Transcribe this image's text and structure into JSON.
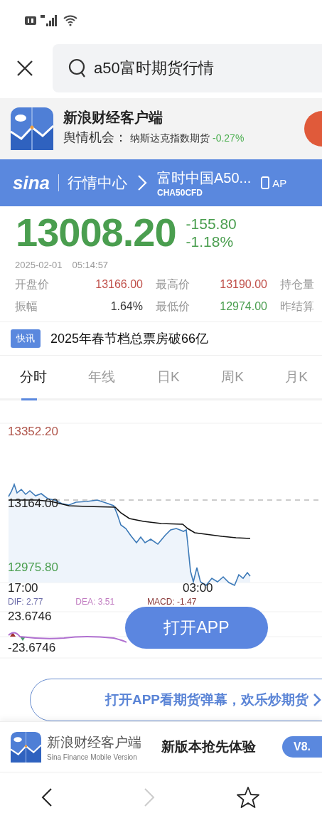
{
  "search": {
    "value": "a50富时期货行情"
  },
  "promo_banner": {
    "title": "新浪财经客户端",
    "label": "舆情机会：",
    "item": "纳斯达克指数期货",
    "change": "-0.27%"
  },
  "header": {
    "logo": "sina",
    "section": "行情中心",
    "title": "富时中国A50...",
    "code": "CHA50CFD",
    "app_link": "AP"
  },
  "quote": {
    "price": "13008.20",
    "change": "-155.80",
    "change_pct": "-1.18%",
    "date": "2025-02-01",
    "time": "05:14:57",
    "stats": [
      {
        "label": "开盘价",
        "value": "13166.00",
        "color": "#c0504a"
      },
      {
        "label": "最高价",
        "value": "13190.00",
        "color": "#c0504a"
      },
      {
        "label": "持仓量"
      },
      {
        "label": "振幅",
        "value": "1.64%",
        "color": "#333333"
      },
      {
        "label": "最低价",
        "value": "12974.00",
        "color": "#4a9e4f"
      },
      {
        "label": "昨结算"
      }
    ]
  },
  "news": {
    "tag": "快讯",
    "headline": "2025年春节档总票房破66亿"
  },
  "tabs": [
    {
      "label": "分时",
      "selected": true
    },
    {
      "label": "年线",
      "selected": false
    },
    {
      "label": "日K",
      "selected": false
    },
    {
      "label": "周K",
      "selected": false
    },
    {
      "label": "月K",
      "selected": false
    }
  ],
  "chart": {
    "high": "13352.20",
    "base": "13164.00",
    "low": "12975.80",
    "times": [
      "17:00",
      "03:00"
    ]
  },
  "macd": {
    "legend": [
      {
        "text": "DIF: 2.77",
        "color": "#6a6aa8"
      },
      {
        "text": "DEA: 3.51",
        "color": "#c07ac0"
      },
      {
        "text": "MACD: -1.47",
        "color": "#8a3a3a"
      }
    ],
    "max": "23.6746",
    "min": "-23.6746"
  },
  "open_app_button": "打开APP",
  "cta_banner": "打开APP看期货弹幕，欢乐炒期货",
  "app_banner": {
    "name": "新浪财经客户端",
    "subtitle": "Sina Finance Mobile Version",
    "slogan": "新版本抢先体验",
    "version": "V8."
  },
  "nav": {
    "forward_disabled": true
  }
}
